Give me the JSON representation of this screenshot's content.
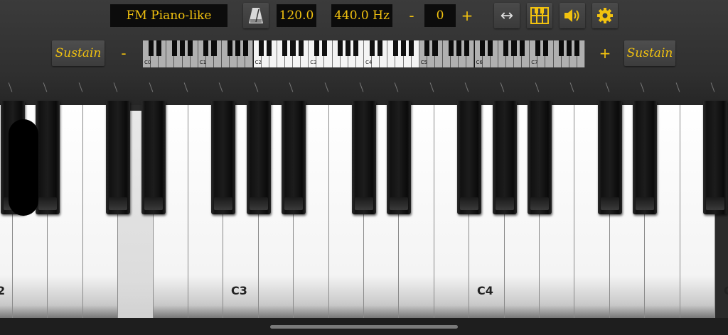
{
  "toolbar": {
    "instrument": "FM Piano-like",
    "tempo": "120.0",
    "tuning": "440.0 Hz",
    "transpose_minus": "-",
    "transpose_value": "0",
    "transpose_plus": "+",
    "swap_icon": "↔",
    "sustain_left": "Sustain",
    "sustain_right": "Sustain",
    "octave_minus": "-",
    "octave_plus": "+"
  },
  "icons": [
    "metronome-icon",
    "swap-arrows-icon",
    "keyboard-grid-icon",
    "speaker-icon",
    "gear-icon"
  ],
  "colors": {
    "accent": "#f2c20f",
    "background": "#2a2a2a",
    "display": "#0c0c0c"
  },
  "mini_keyboard": {
    "octave_labels": [
      "C0",
      "C1",
      "C2",
      "C3",
      "C4",
      "C5",
      "C6",
      "C7"
    ],
    "visible_range": [
      "C2",
      "C5"
    ]
  },
  "keyboard": {
    "labels": [
      "2",
      "C3",
      "C4",
      "C"
    ],
    "pressed_key": "D3"
  }
}
